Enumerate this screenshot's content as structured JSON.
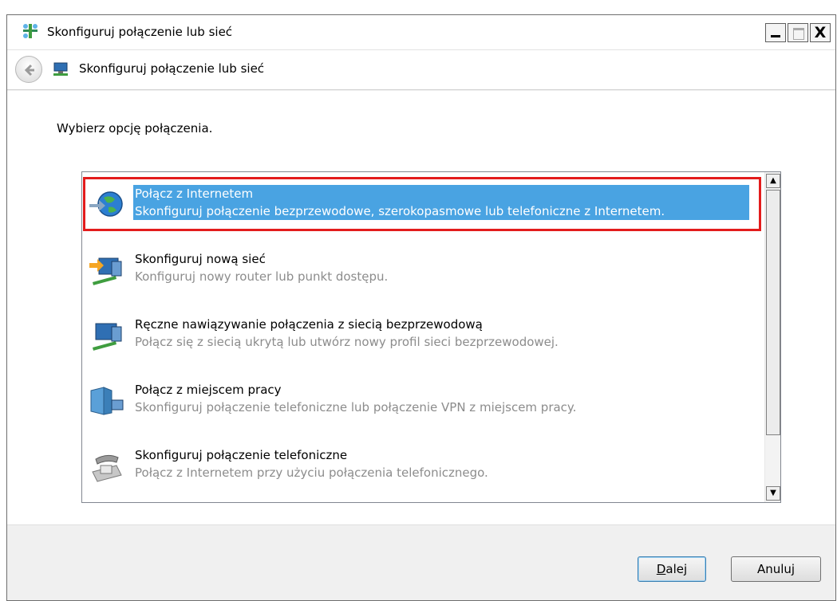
{
  "window": {
    "title": "Skonfiguruj połączenie lub sieć",
    "controls": {
      "minimize": "_",
      "maximize": "□",
      "close": "X"
    }
  },
  "navbar": {
    "title": "Skonfiguruj połączenie lub sieć"
  },
  "main": {
    "prompt": "Wybierz opcję połączenia.",
    "options": [
      {
        "title": "Połącz z Internetem",
        "description": "Skonfiguruj połączenie bezprzewodowe, szerokopasmowe lub telefoniczne z Internetem.",
        "icon": "globe-connect-icon",
        "selected": true
      },
      {
        "title": "Skonfiguruj nową sieć",
        "description": "Konfiguruj nowy router lub punkt dostępu.",
        "icon": "new-network-icon",
        "selected": false
      },
      {
        "title": "Ręczne nawiązywanie połączenia z siecią bezprzewodową",
        "description": "Połącz się z siecią ukrytą lub utwórz nowy profil sieci bezprzewodowej.",
        "icon": "wireless-network-icon",
        "selected": false
      },
      {
        "title": "Połącz z miejscem pracy",
        "description": "Skonfiguruj połączenie telefoniczne lub połączenie VPN z miejscem pracy.",
        "icon": "workplace-icon",
        "selected": false
      },
      {
        "title": "Skonfiguruj połączenie telefoniczne",
        "description": "Połącz z Internetem przy użyciu połączenia telefonicznego.",
        "icon": "dialup-phone-icon",
        "selected": false
      }
    ]
  },
  "footer": {
    "next_label_underlined": "D",
    "next_label_rest": "alej",
    "cancel_label": "Anuluj"
  },
  "colors": {
    "selection": "#49a3e2",
    "highlight_border": "#e31c1c",
    "description_text": "#8c8c8c"
  }
}
